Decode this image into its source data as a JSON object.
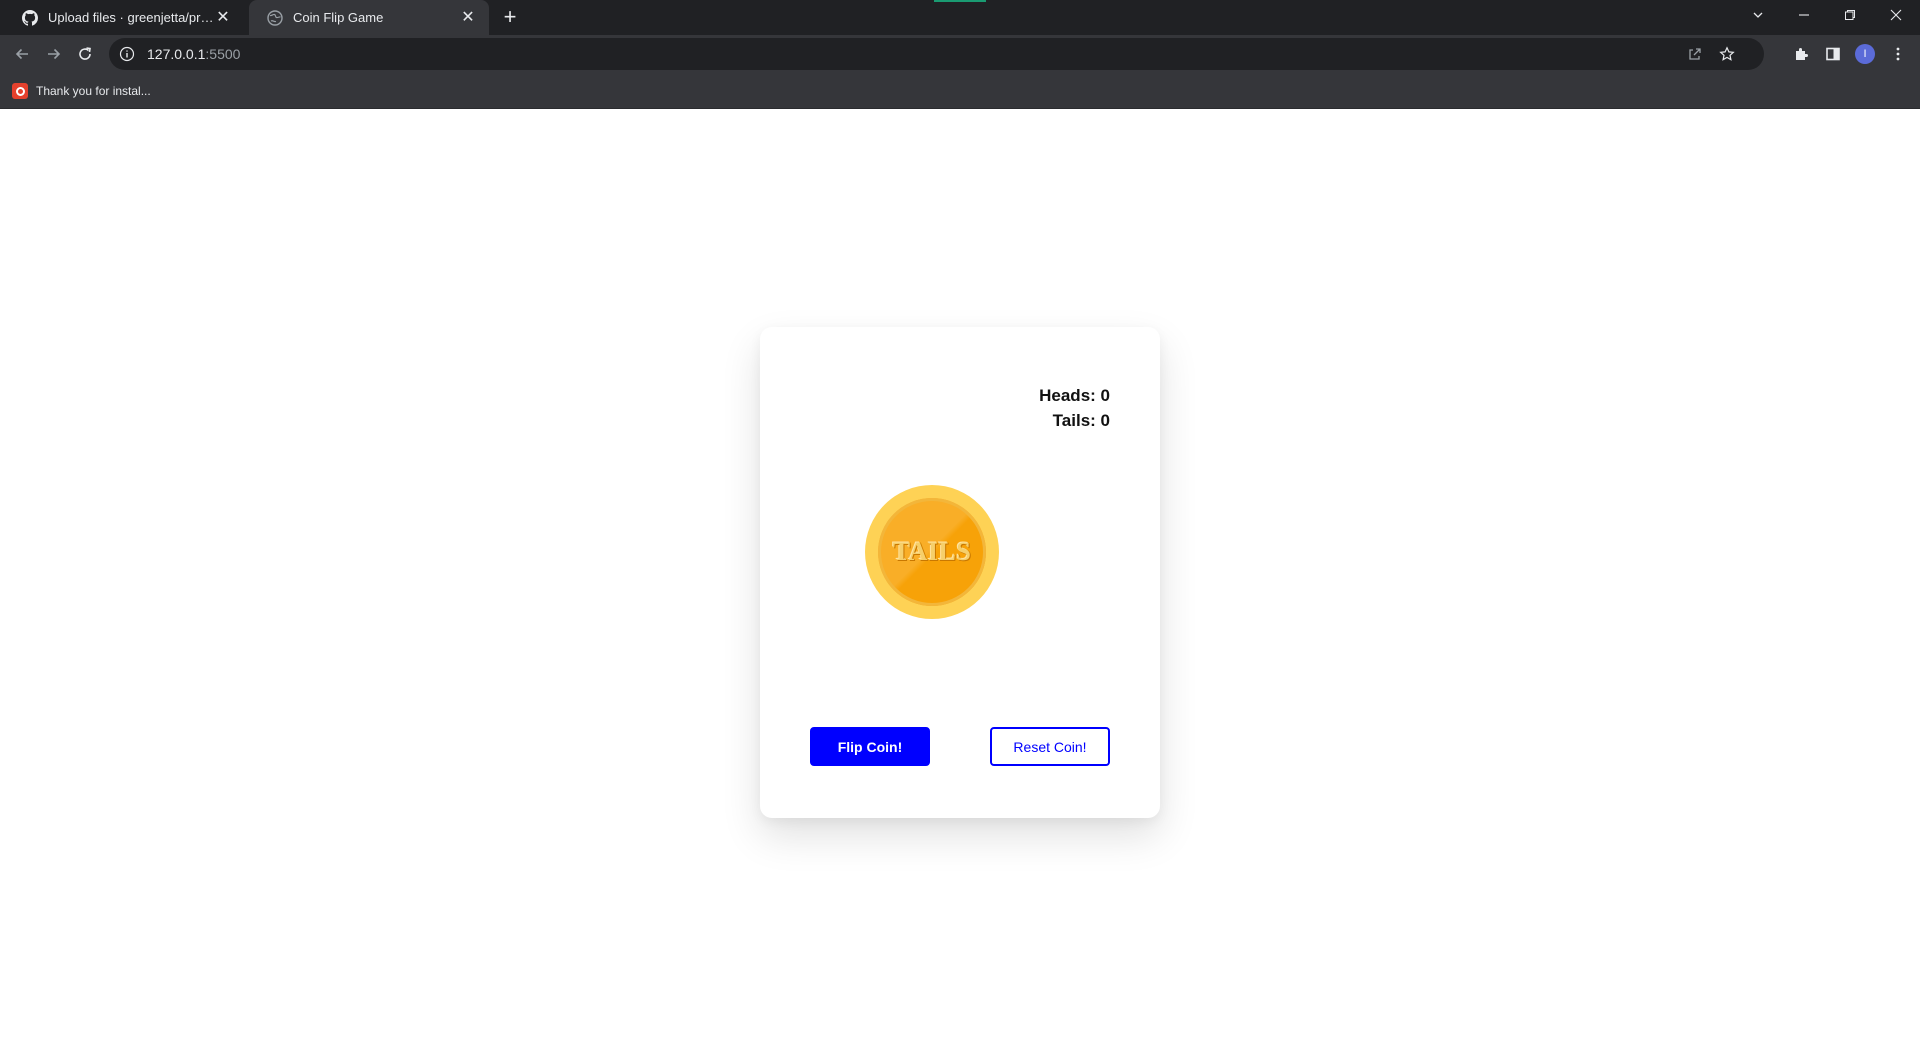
{
  "browser": {
    "tabs": [
      {
        "title": "Upload files · greenjetta/projects",
        "icon": "github-icon",
        "active": false
      },
      {
        "title": "Coin Flip Game",
        "icon": "globe-icon",
        "active": true
      }
    ],
    "new_tab_label": "+",
    "address": {
      "host": "127.0.0.1",
      "port": ":5500"
    },
    "bookmarks": [
      {
        "label": "Thank you for instal...",
        "icon": "opera-o-icon"
      }
    ],
    "profile_initial": "I",
    "colors": {
      "tabstrip": "#202124",
      "toolbar": "#35363a",
      "accent": "#1a9b72",
      "avatar": "#5b6bd8"
    }
  },
  "game": {
    "heads_label": "Heads: 0",
    "tails_label": "Tails: 0",
    "coin_face": "TAILS",
    "flip_button": "Flip Coin!",
    "reset_button": "Reset Coin!",
    "colors": {
      "primary": "#0000ff",
      "coin_outer": "#fed255",
      "coin_inner": "#f9ae27"
    }
  }
}
